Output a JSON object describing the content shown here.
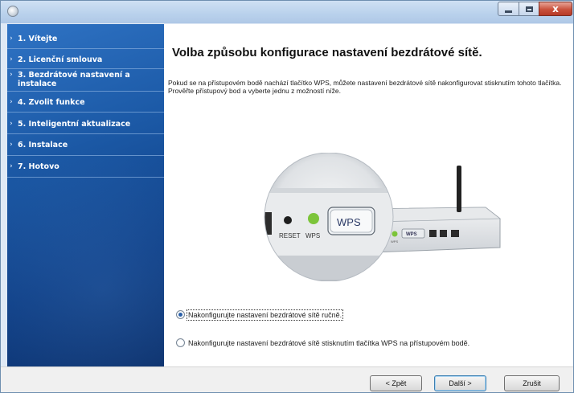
{
  "sidebar": {
    "items": [
      {
        "label": "1. Vítejte"
      },
      {
        "label": "2. Licenční smlouva"
      },
      {
        "label": "3. Bezdrátové nastavení a instalace"
      },
      {
        "label": "4. Zvolit funkce"
      },
      {
        "label": "5. Inteligentní aktualizace"
      },
      {
        "label": "6. Instalace"
      },
      {
        "label": "7. Hotovo"
      }
    ],
    "chevron": "›"
  },
  "main": {
    "title": "Volba způsobu konfigurace nastavení bezdrátové sítě.",
    "description": "Pokud se na přístupovém bodě nachází tlačítko WPS, můžete nastavení bezdrátové sítě nakonfigurovat stisknutím tohoto tlačítka.",
    "instruction": "Prověřte přístupový bod a vyberte jednu z možností níže.",
    "illustration": {
      "reset_label": "RESET",
      "wps_label": "WPS",
      "wps_button_label": "WPS",
      "router_wps_label": "WPS",
      "led_color": "#7cc43a"
    },
    "options": [
      {
        "label": "Nakonfigurujte nastavení bezdrátové sítě ručně.",
        "selected": true
      },
      {
        "label": "Nakonfigurujte nastavení bezdrátové sítě stisknutím tlačítka WPS na přístupovém bodě.",
        "selected": false
      }
    ]
  },
  "footer": {
    "back_label": "< Zpět",
    "next_label": "Další >",
    "cancel_label": "Zrušit"
  },
  "window": {
    "close_glyph": "x"
  },
  "colors": {
    "sidebar_top": "#2f73c4",
    "sidebar_bottom": "#0b2f6a",
    "close_button": "#c9513c"
  }
}
